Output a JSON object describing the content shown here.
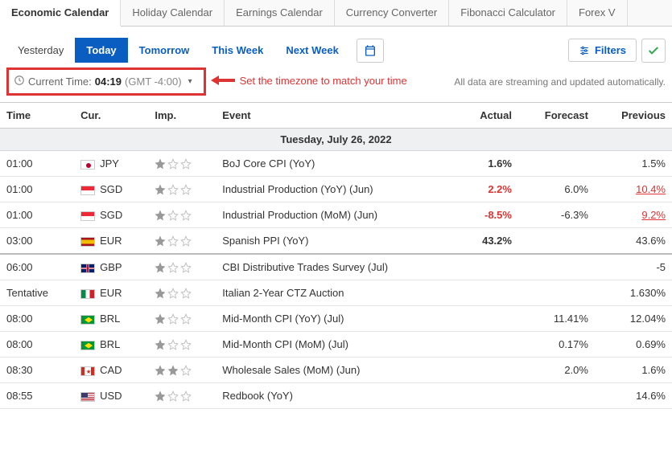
{
  "topTabs": [
    "Economic Calendar",
    "Holiday Calendar",
    "Earnings Calendar",
    "Currency Converter",
    "Fibonacci Calculator",
    "Forex V"
  ],
  "activeTopTab": 0,
  "dayTabs": [
    "Yesterday",
    "Today",
    "Tomorrow",
    "This Week",
    "Next Week"
  ],
  "activeDayTab": 1,
  "filtersLabel": "Filters",
  "timezone": {
    "label": "Current Time:",
    "time": "04:19",
    "zone": "(GMT -4:00)"
  },
  "annotation": "Set the timezone to match your time",
  "streamNote": "All data are streaming and updated automatically.",
  "columns": [
    "Time",
    "Cur.",
    "Imp.",
    "Event",
    "Actual",
    "Forecast",
    "Previous"
  ],
  "dateHeader": "Tuesday, July 26, 2022",
  "events": [
    {
      "time": "01:00",
      "cur": "JPY",
      "flag": "JPY",
      "imp": 1,
      "event": "BoJ Core CPI (YoY)",
      "actual": "1.6%",
      "actualCls": "bold",
      "forecast": "",
      "previous": "1.5%",
      "prevCls": ""
    },
    {
      "time": "01:00",
      "cur": "SGD",
      "flag": "SGD",
      "imp": 1,
      "event": "Industrial Production (YoY) (Jun)",
      "actual": "2.2%",
      "actualCls": "bold red",
      "forecast": "6.0%",
      "previous": "10.4%",
      "prevCls": "red-u"
    },
    {
      "time": "01:00",
      "cur": "SGD",
      "flag": "SGD",
      "imp": 1,
      "event": "Industrial Production (MoM) (Jun)",
      "actual": "-8.5%",
      "actualCls": "bold red",
      "forecast": "-6.3%",
      "previous": "9.2%",
      "prevCls": "red-u"
    },
    {
      "time": "03:00",
      "cur": "EUR",
      "flag": "EUR",
      "imp": 1,
      "event": "Spanish PPI (YoY)",
      "actual": "43.2%",
      "actualCls": "bold",
      "forecast": "",
      "previous": "43.6%",
      "prevCls": ""
    },
    {
      "time": "06:00",
      "cur": "GBP",
      "flag": "GBP",
      "imp": 1,
      "event": "CBI Distributive Trades Survey (Jul)",
      "actual": "",
      "actualCls": "",
      "forecast": "",
      "previous": "-5",
      "prevCls": "",
      "section": true
    },
    {
      "time": "Tentative",
      "cur": "EUR",
      "flag": "IT",
      "imp": 1,
      "event": "Italian 2-Year CTZ Auction",
      "actual": "",
      "actualCls": "",
      "forecast": "",
      "previous": "1.630%",
      "prevCls": ""
    },
    {
      "time": "08:00",
      "cur": "BRL",
      "flag": "BRL",
      "imp": 1,
      "event": "Mid-Month CPI (YoY) (Jul)",
      "actual": "",
      "actualCls": "",
      "forecast": "11.41%",
      "previous": "12.04%",
      "prevCls": ""
    },
    {
      "time": "08:00",
      "cur": "BRL",
      "flag": "BRL",
      "imp": 1,
      "event": "Mid-Month CPI (MoM) (Jul)",
      "actual": "",
      "actualCls": "",
      "forecast": "0.17%",
      "previous": "0.69%",
      "prevCls": ""
    },
    {
      "time": "08:30",
      "cur": "CAD",
      "flag": "CAD",
      "imp": 2,
      "event": "Wholesale Sales (MoM) (Jun)",
      "actual": "",
      "actualCls": "",
      "forecast": "2.0%",
      "previous": "1.6%",
      "prevCls": ""
    },
    {
      "time": "08:55",
      "cur": "USD",
      "flag": "USD",
      "imp": 1,
      "event": "Redbook (YoY)",
      "actual": "",
      "actualCls": "",
      "forecast": "",
      "previous": "14.6%",
      "prevCls": ""
    }
  ]
}
